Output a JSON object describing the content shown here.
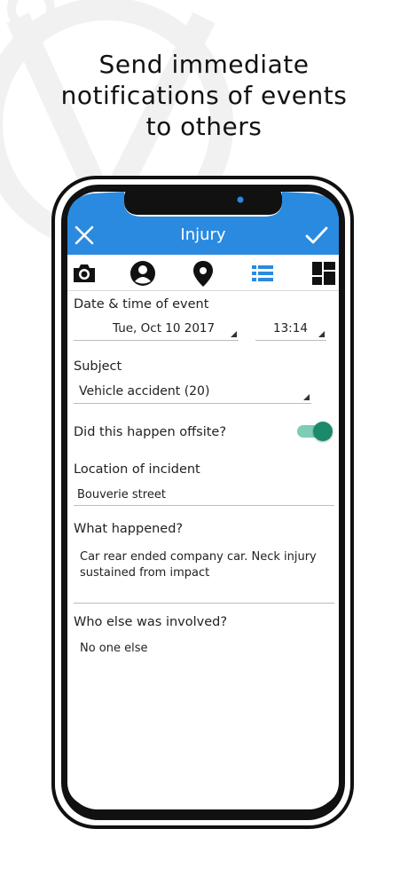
{
  "headline": {
    "lines": [
      "Send immediate",
      "notifications of events",
      "to others"
    ]
  },
  "app_bar": {
    "title": "Injury",
    "close_icon": "close-icon",
    "confirm_icon": "check-icon",
    "color": "#2a8ae0"
  },
  "tabs": [
    {
      "icon": "camera-icon",
      "active": false
    },
    {
      "icon": "person-icon",
      "active": false
    },
    {
      "icon": "location-pin-icon",
      "active": false
    },
    {
      "icon": "list-icon",
      "active": true
    },
    {
      "icon": "dashboard-icon",
      "active": false
    }
  ],
  "form": {
    "datetime": {
      "label": "Date & time of event",
      "date": "Tue, Oct 10 2017",
      "time": "13:14"
    },
    "subject": {
      "label": "Subject",
      "value": "Vehicle accident (20)"
    },
    "offsite": {
      "label": "Did this happen offsite?",
      "on": true,
      "color": "#1a8a6b"
    },
    "location": {
      "label": "Location of incident",
      "value": "Bouverie street"
    },
    "what_happened": {
      "label": "What happened?",
      "value": "Car rear ended company car. Neck injury sustained from impact"
    },
    "who_else": {
      "label": "Who else was involved?",
      "value": "No one else"
    }
  }
}
